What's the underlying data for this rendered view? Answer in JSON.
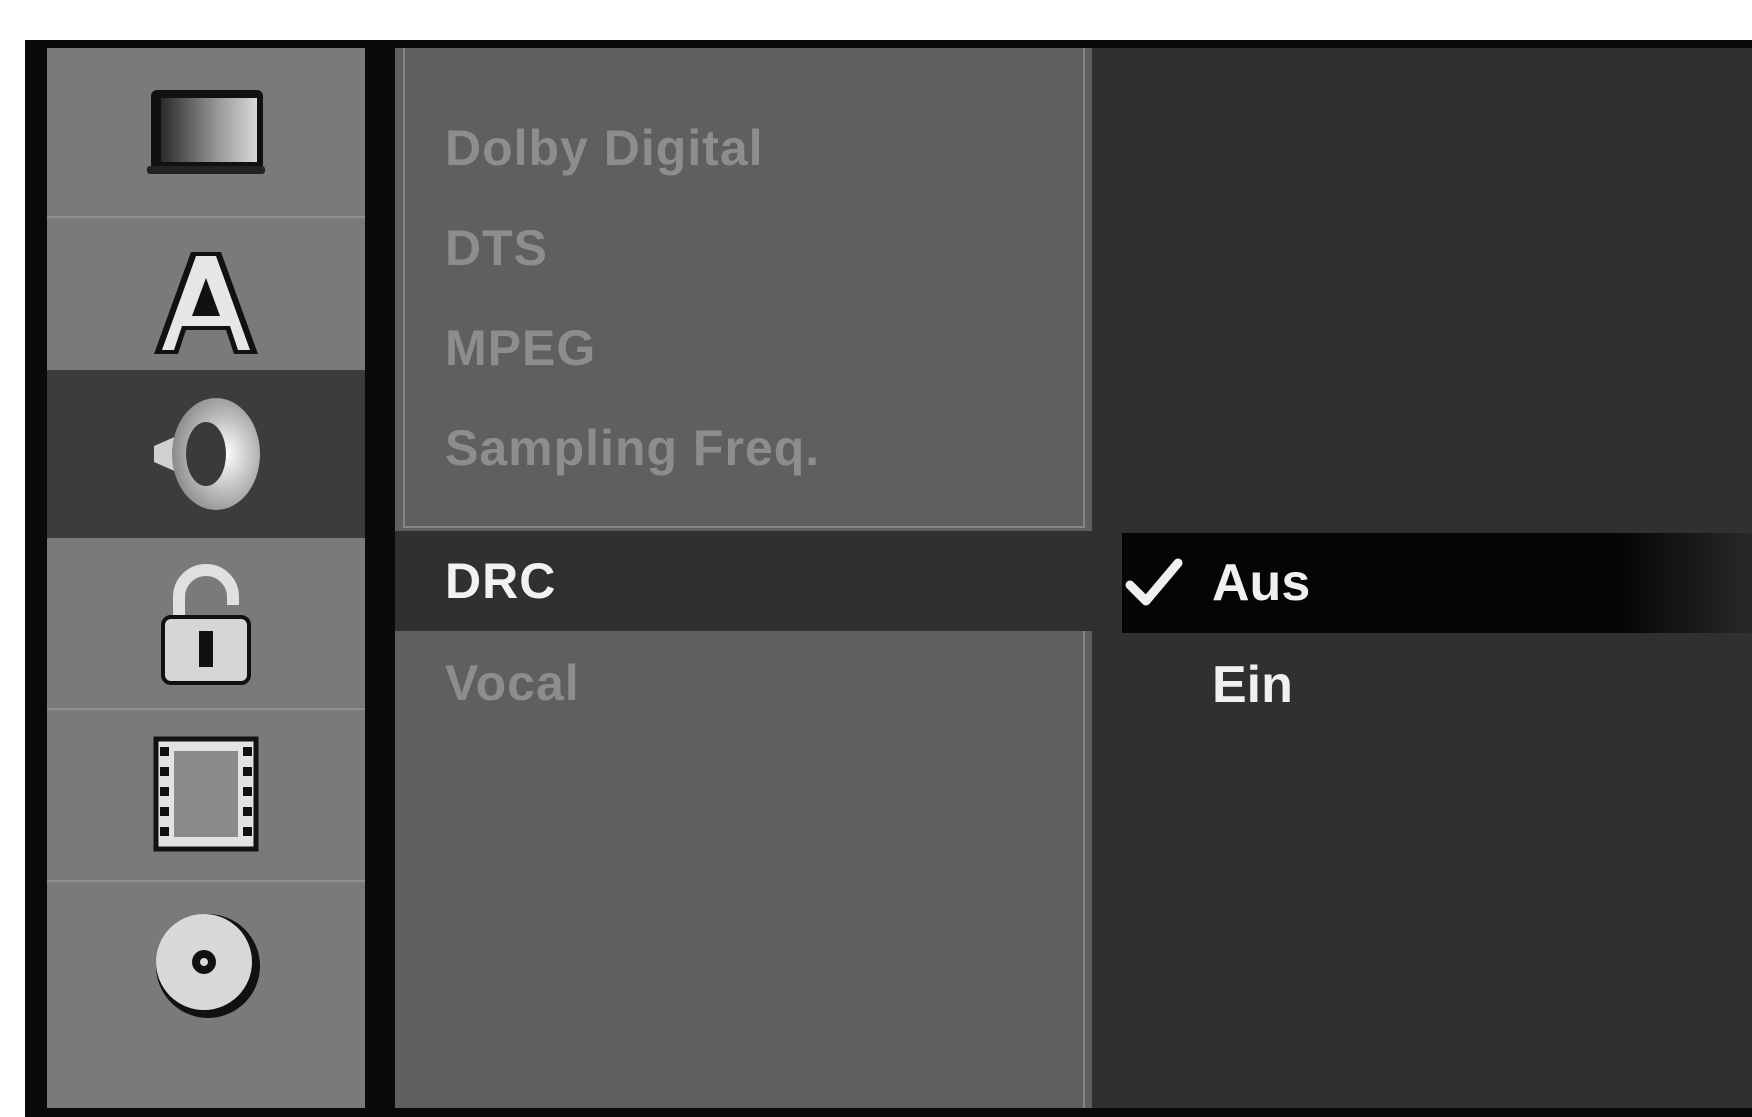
{
  "sidebar": {
    "items": [
      {
        "icon": "monitor-icon"
      },
      {
        "icon": "language-a-icon"
      },
      {
        "icon": "speaker-icon",
        "active": true
      },
      {
        "icon": "lock-icon"
      },
      {
        "icon": "film-icon"
      },
      {
        "icon": "disc-icon"
      }
    ]
  },
  "menu": {
    "items": [
      {
        "label": "Dolby Digital"
      },
      {
        "label": "DTS"
      },
      {
        "label": "MPEG"
      },
      {
        "label": "Sampling Freq."
      },
      {
        "label": "DRC",
        "selected": true
      },
      {
        "label": "Vocal"
      }
    ]
  },
  "options": {
    "items": [
      {
        "label": "Aus",
        "checked": true
      },
      {
        "label": "Ein"
      }
    ]
  },
  "colors": {
    "sidebar_bg": "#7a7a7a",
    "menu_bg": "#5f5f5f",
    "options_bg": "#303030",
    "highlight": "#050505"
  }
}
